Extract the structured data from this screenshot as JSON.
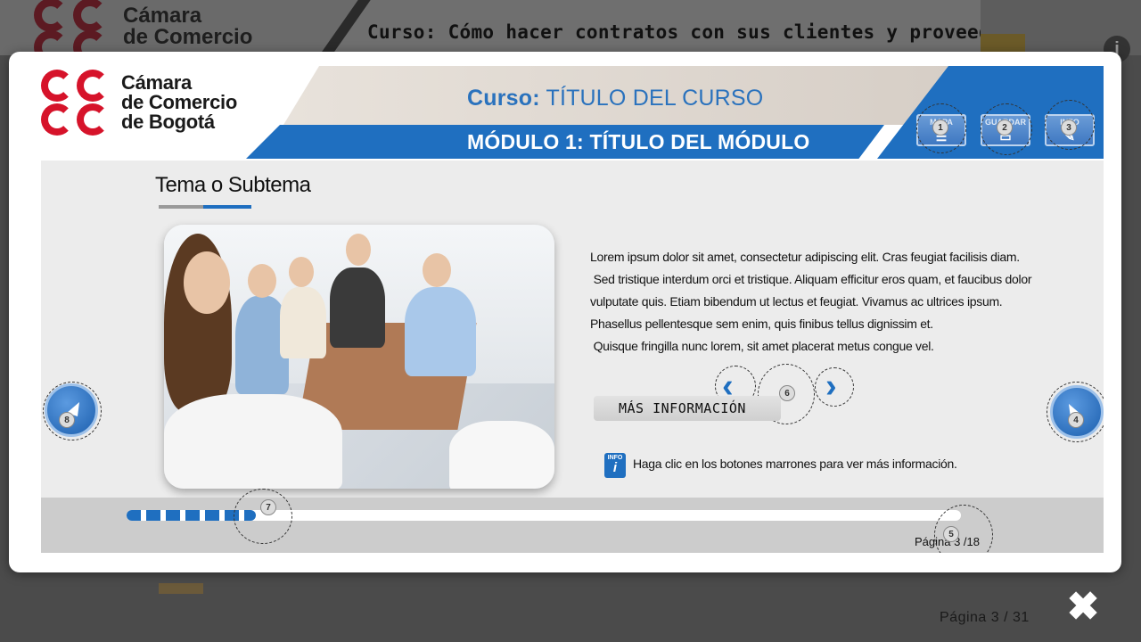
{
  "background": {
    "logo": [
      "Cámara",
      "de Comercio"
    ],
    "course_title": "Curso: Cómo hacer contratos con sus clientes y proveedores",
    "page_indicator": "Página 3 / 31",
    "close_label": "✖"
  },
  "slide": {
    "logo": [
      "Cámara",
      "de Comercio",
      "de Bogotá"
    ],
    "course_prefix": "Curso:",
    "course_title": "TÍTULO DEL CURSO",
    "module_title": "MÓDULO 1: TÍTULO DEL MÓDULO",
    "header_buttons": [
      {
        "label": "MAPA",
        "marker": "1",
        "icon": "map-icon"
      },
      {
        "label": "GUARDAR",
        "marker": "2",
        "icon": "save-icon"
      },
      {
        "label": "INFO",
        "marker": "3",
        "icon": "info-icon"
      }
    ],
    "topic_title": "Tema o Subtema",
    "body_lines": [
      "Lorem ipsum dolor sit amet, consectetur adipiscing elit. Cras feugiat facilisis diam.",
      " Sed tristique interdum orci et tristique. Aliquam efficitur eros quam, et faucibus dolor",
      "vulputate quis. Etiam bibendum ut lectus et feugiat. Vivamus ac ultrices ipsum.",
      "Phasellus pellentesque sem enim, quis finibus tellus dignissim et.",
      " Quisque fringilla nunc lorem, sit amet placerat metus congue vel."
    ],
    "more_info_label": "MÁS INFORMACIÓN",
    "info_icon_label": "INFO",
    "hint_text": "Haga clic en los botones marrones para ver más información.",
    "markers": {
      "next": "4",
      "page": "5",
      "carousel": "6",
      "progress": "7",
      "prev": "8"
    },
    "progress": {
      "fraction": 0.155
    },
    "page_label": "Página 3 /18"
  },
  "colors": {
    "brand_red": "#d6132a",
    "brand_blue": "#1f6fc0"
  }
}
